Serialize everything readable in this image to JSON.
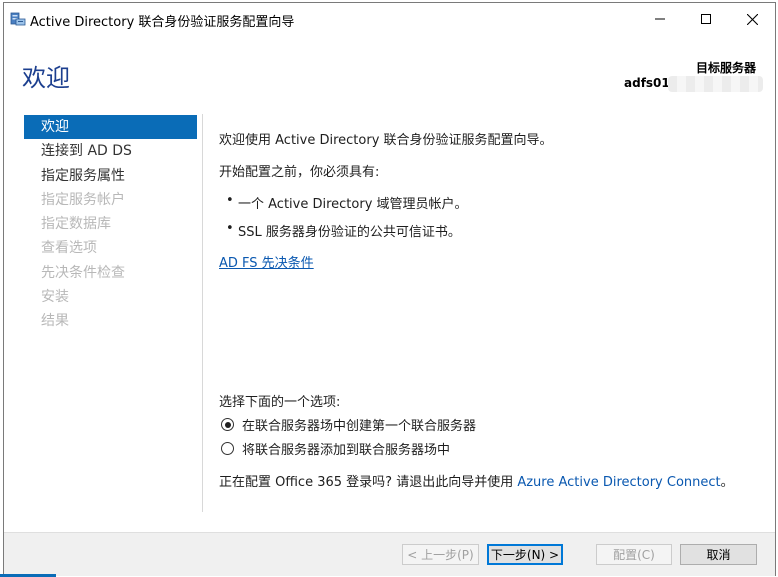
{
  "window": {
    "title": "Active Directory 联合身份验证服务配置向导"
  },
  "header": {
    "page_title": "欢迎",
    "target_server_label": "目标服务器",
    "target_server_value": "adfs01"
  },
  "nav": {
    "items": [
      {
        "label": "欢迎",
        "state": "active"
      },
      {
        "label": "连接到 AD DS",
        "state": "enabled"
      },
      {
        "label": "指定服务属性",
        "state": "enabled"
      },
      {
        "label": "指定服务帐户",
        "state": "disabled"
      },
      {
        "label": "指定数据库",
        "state": "disabled"
      },
      {
        "label": "查看选项",
        "state": "disabled"
      },
      {
        "label": "先决条件检查",
        "state": "disabled"
      },
      {
        "label": "安装",
        "state": "disabled"
      },
      {
        "label": "结果",
        "state": "disabled"
      }
    ]
  },
  "main": {
    "welcome_text": "欢迎使用 Active Directory 联合身份验证服务配置向导。",
    "prereq_intro": "开始配置之前，你必须具有:",
    "prereq_items": [
      "一个 Active Directory 域管理员帐户。",
      "SSL 服务器身份验证的公共可信证书。"
    ],
    "prereq_link": "AD FS 先决条件",
    "options_label": "选择下面的一个选项:",
    "options": [
      {
        "label": "在联合服务器场中创建第一个联合服务器",
        "checked": true
      },
      {
        "label": "将联合服务器添加到联合服务器场中",
        "checked": false
      }
    ],
    "o365_text": "正在配置 Office 365 登录吗? 请退出此向导并使用 ",
    "o365_link": "Azure Active Directory Connect",
    "o365_end": "。"
  },
  "footer": {
    "prev_label": "< 上一步(P)",
    "next_label": "下一步(N) >",
    "configure_label": "配置(C)",
    "cancel_label": "取消"
  },
  "colors": {
    "accent": "#0a6cb7",
    "title_blue": "#1c3f8f",
    "link": "#0a58b0"
  }
}
